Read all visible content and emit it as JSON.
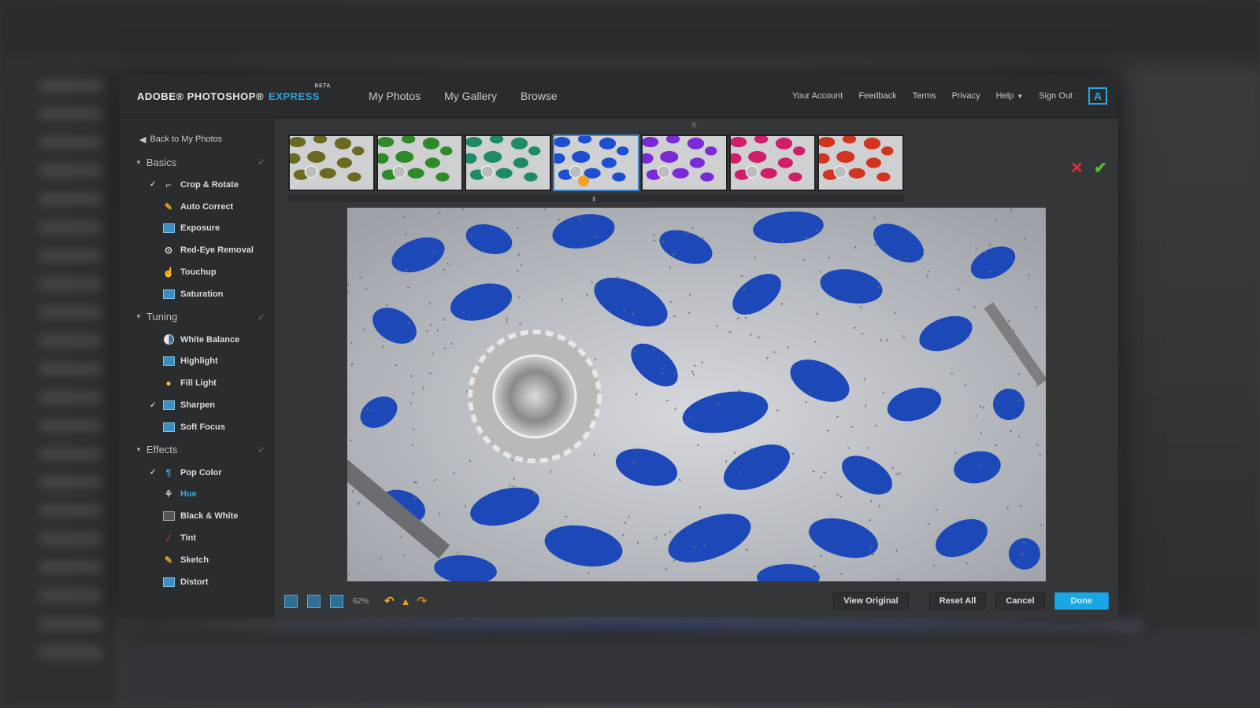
{
  "header": {
    "logo_main": "ADOBE® PHOTOSHOP®",
    "logo_express": "EXPRESS",
    "logo_beta": "BETA",
    "nav": [
      "My Photos",
      "My Gallery",
      "Browse"
    ],
    "links": {
      "account": "Your Account",
      "feedback": "Feedback",
      "terms": "Terms",
      "privacy": "Privacy",
      "help": "Help",
      "signout": "Sign Out"
    },
    "adobe_icon": "adobe-logo-icon"
  },
  "sidebar": {
    "back": "Back to My Photos",
    "sections": [
      {
        "title": "Basics",
        "tools": [
          {
            "label": "Crop & Rotate",
            "checked": true,
            "icon": "crop-icon"
          },
          {
            "label": "Auto Correct",
            "checked": false,
            "icon": "wand-icon"
          },
          {
            "label": "Exposure",
            "checked": false,
            "icon": "exposure-icon"
          },
          {
            "label": "Red-Eye Removal",
            "checked": false,
            "icon": "eye-icon"
          },
          {
            "label": "Touchup",
            "checked": false,
            "icon": "hand-icon"
          },
          {
            "label": "Saturation",
            "checked": false,
            "icon": "saturation-icon"
          }
        ]
      },
      {
        "title": "Tuning",
        "tools": [
          {
            "label": "White Balance",
            "checked": false,
            "icon": "white-balance-icon"
          },
          {
            "label": "Highlight",
            "checked": false,
            "icon": "highlight-icon"
          },
          {
            "label": "Fill Light",
            "checked": false,
            "icon": "bulb-icon"
          },
          {
            "label": "Sharpen",
            "checked": true,
            "icon": "sharpen-icon"
          },
          {
            "label": "Soft Focus",
            "checked": false,
            "icon": "soft-focus-icon"
          }
        ]
      },
      {
        "title": "Effects",
        "tools": [
          {
            "label": "Pop Color",
            "checked": true,
            "icon": "pop-color-icon"
          },
          {
            "label": "Hue",
            "checked": false,
            "icon": "hue-icon",
            "active": true
          },
          {
            "label": "Black & White",
            "checked": false,
            "icon": "black-white-icon"
          },
          {
            "label": "Tint",
            "checked": false,
            "icon": "tint-icon"
          },
          {
            "label": "Sketch",
            "checked": false,
            "icon": "sketch-icon"
          },
          {
            "label": "Distort",
            "checked": false,
            "icon": "distort-icon"
          }
        ]
      }
    ]
  },
  "thumbnails": {
    "colors": [
      "#6b6a20",
      "#2f8a2a",
      "#1f8a6a",
      "#1d4fd0",
      "#7a2ad6",
      "#d01e6a",
      "#d2341e"
    ],
    "selected_index": 3
  },
  "bottom": {
    "zoom": "62%",
    "view_original": "View Original",
    "reset_all": "Reset All",
    "cancel": "Cancel",
    "done": "Done"
  },
  "colors": {
    "accent": "#27a7df",
    "reject": "#d9343b",
    "accept": "#4cc32c",
    "petal": "#1d49b8"
  }
}
